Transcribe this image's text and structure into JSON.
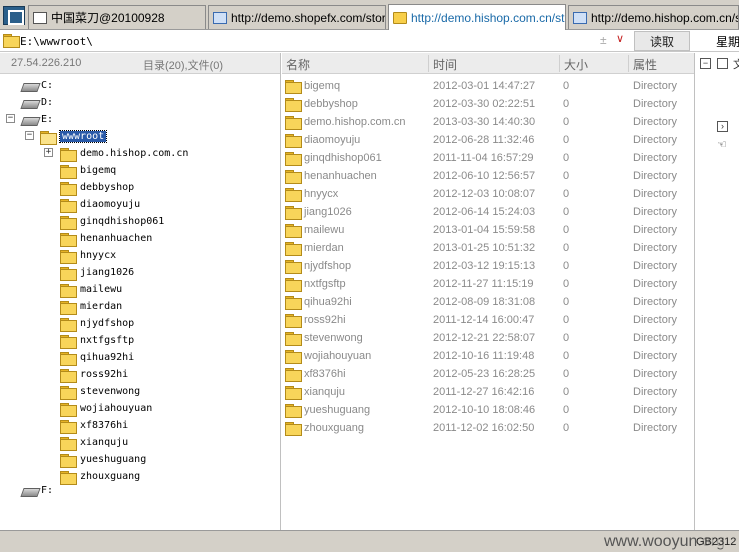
{
  "tabs": [
    {
      "label": "中国菜刀@20100928",
      "icon": "page-icon"
    },
    {
      "label": "http://demo.shopefx.com/stor...",
      "icon": "ie-icon"
    },
    {
      "label": "http://demo.hishop.com.cn/st...",
      "icon": "folder-icon",
      "active": true
    },
    {
      "label": "http://demo.hishop.com.cn/st...",
      "icon": "ie-icon"
    }
  ],
  "address": {
    "value": "E:\\wwwroot\\",
    "plus": "±",
    "dropdown": "∨",
    "read_button": "读取",
    "right_label": "星期"
  },
  "left": {
    "ip": "27.54.226.210",
    "counts": "目录(20),文件(0)",
    "drives": [
      "C:",
      "D:",
      "E:",
      "F:"
    ],
    "root_folder": "wwwroot",
    "expanded_folder": "demo.hishop.com.cn",
    "folders": [
      "bigemq",
      "debbyshop",
      "diaomoyuju",
      "ginqdhishop061",
      "henanhuachen",
      "hnyycx",
      "jiang1026",
      "mailewu",
      "mierdan",
      "njydfshop",
      "nxtfgsftp",
      "qihua92hi",
      "ross92hi",
      "stevenwong",
      "wojiahouyuan",
      "xf8376hi",
      "xianquju",
      "yueshuguang",
      "zhouxguang"
    ]
  },
  "list": {
    "headers": {
      "name": "名称",
      "time": "时间",
      "size": "大小",
      "attr": "属性"
    },
    "rows": [
      {
        "name": "bigemq",
        "time": "2012-03-01 14:47:27",
        "size": "0",
        "attr": "Directory"
      },
      {
        "name": "debbyshop",
        "time": "2012-03-30 02:22:51",
        "size": "0",
        "attr": "Directory"
      },
      {
        "name": "demo.hishop.com.cn",
        "time": "2013-03-30 14:40:30",
        "size": "0",
        "attr": "Directory"
      },
      {
        "name": "diaomoyuju",
        "time": "2012-06-28 11:32:46",
        "size": "0",
        "attr": "Directory"
      },
      {
        "name": "ginqdhishop061",
        "time": "2011-11-04 16:57:29",
        "size": "0",
        "attr": "Directory"
      },
      {
        "name": "henanhuachen",
        "time": "2012-06-10 12:56:57",
        "size": "0",
        "attr": "Directory"
      },
      {
        "name": "hnyycx",
        "time": "2012-12-03 10:08:07",
        "size": "0",
        "attr": "Directory"
      },
      {
        "name": "jiang1026",
        "time": "2012-06-14 15:24:03",
        "size": "0",
        "attr": "Directory"
      },
      {
        "name": "mailewu",
        "time": "2013-01-04 15:59:58",
        "size": "0",
        "attr": "Directory"
      },
      {
        "name": "mierdan",
        "time": "2013-01-25 10:51:32",
        "size": "0",
        "attr": "Directory"
      },
      {
        "name": "njydfshop",
        "time": "2012-03-12 19:15:13",
        "size": "0",
        "attr": "Directory"
      },
      {
        "name": "nxtfgsftp",
        "time": "2012-11-27 11:15:19",
        "size": "0",
        "attr": "Directory"
      },
      {
        "name": "qihua92hi",
        "time": "2012-08-09 18:31:08",
        "size": "0",
        "attr": "Directory"
      },
      {
        "name": "ross92hi",
        "time": "2011-12-14 16:00:47",
        "size": "0",
        "attr": "Directory"
      },
      {
        "name": "stevenwong",
        "time": "2012-12-21 22:58:07",
        "size": "0",
        "attr": "Directory"
      },
      {
        "name": "wojiahouyuan",
        "time": "2012-10-16 11:19:48",
        "size": "0",
        "attr": "Directory"
      },
      {
        "name": "xf8376hi",
        "time": "2012-05-23 16:28:25",
        "size": "0",
        "attr": "Directory"
      },
      {
        "name": "xianquju",
        "time": "2011-12-27 16:42:16",
        "size": "0",
        "attr": "Directory"
      },
      {
        "name": "yueshuguang",
        "time": "2012-10-10 18:08:46",
        "size": "0",
        "attr": "Directory"
      },
      {
        "name": "zhouxguang",
        "time": "2011-12-02 16:02:50",
        "size": "0",
        "attr": "Directory"
      }
    ]
  },
  "right_pane": {
    "minus": "−",
    "glyph_char": "文"
  },
  "status": {
    "watermark": "www.wooyun.org",
    "number": "GB2312"
  },
  "colors": {
    "selection": "#2a5aa8",
    "active_tab_text": "#1a6aa8",
    "folder": "#f8d55a",
    "list_text": "#8a8a8a"
  }
}
